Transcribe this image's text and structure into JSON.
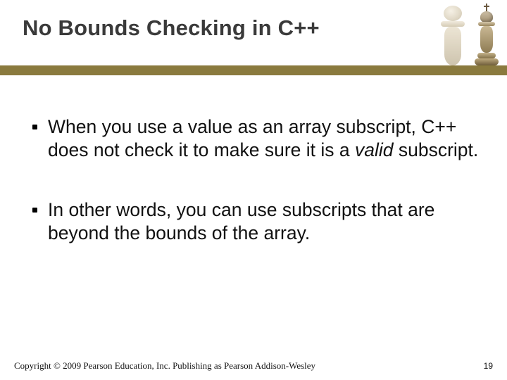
{
  "slide": {
    "title": "No Bounds Checking in C++",
    "bullets": [
      {
        "pre": "When you use a value as an array subscript, C++ does not check it to make sure it is a ",
        "emph": "valid",
        "post": " subscript."
      },
      {
        "pre": "In other words, you can use subscripts that are beyond the bounds of the array.",
        "emph": "",
        "post": ""
      }
    ],
    "footer": {
      "copyright": "Copyright © 2009 Pearson Education, Inc. Publishing as Pearson Addison-Wesley",
      "page": "19"
    }
  }
}
